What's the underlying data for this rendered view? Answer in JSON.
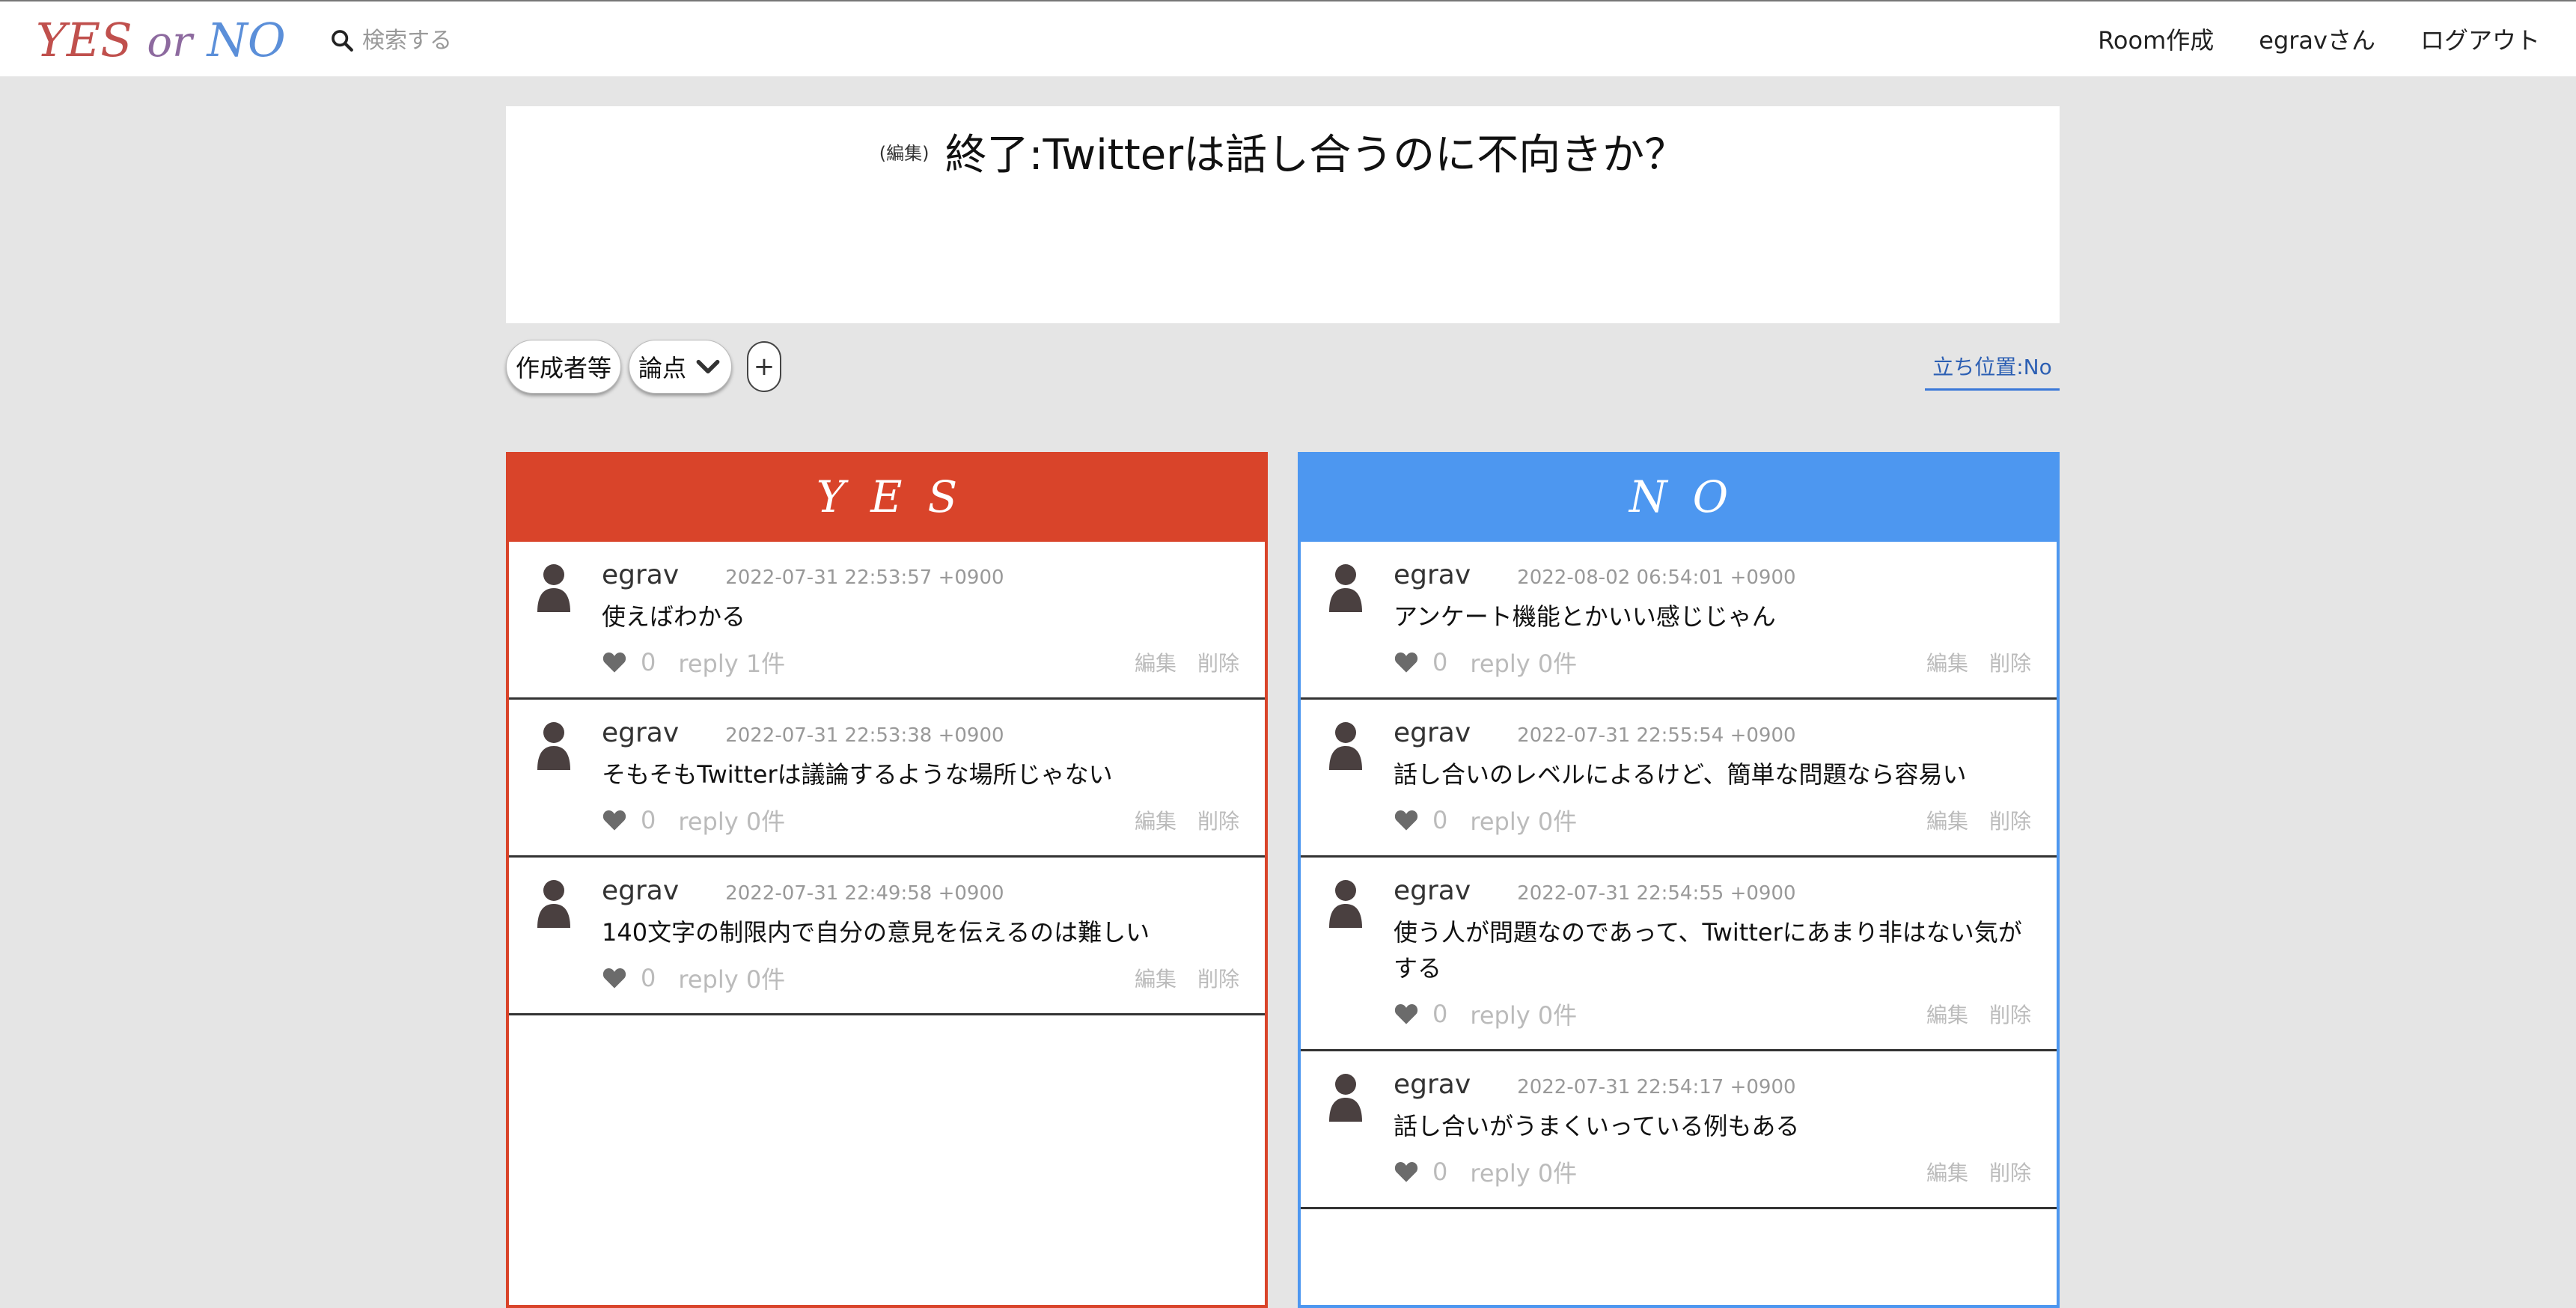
{
  "navbar": {
    "logo": {
      "yes": "YES",
      "or": "or",
      "no": "NO"
    },
    "search_placeholder": "検索する",
    "links": [
      "Room作成",
      "egravさん",
      "ログアウト"
    ]
  },
  "room": {
    "edit_label": "(編集)",
    "title": "終了:Twitterは話し合うのに不向きか？"
  },
  "controls": {
    "author_label": "作成者等",
    "points_label": "論点",
    "add_label": "+",
    "position_label": "立ち位置:No"
  },
  "columns": {
    "yes": {
      "header": "YES",
      "comments": [
        {
          "author": "egrav",
          "time": "2022-07-31 22:53:57 +0900",
          "body": "使えばわかる",
          "likes": "0",
          "reply": "reply 1件",
          "edit": "編集",
          "delete": "削除"
        },
        {
          "author": "egrav",
          "time": "2022-07-31 22:53:38 +0900",
          "body": "そもそもTwitterは議論するような場所じゃない",
          "likes": "0",
          "reply": "reply 0件",
          "edit": "編集",
          "delete": "削除"
        },
        {
          "author": "egrav",
          "time": "2022-07-31 22:49:58 +0900",
          "body": "140文字の制限内で自分の意見を伝えるのは難しい",
          "likes": "0",
          "reply": "reply 0件",
          "edit": "編集",
          "delete": "削除"
        }
      ]
    },
    "no": {
      "header": "NO",
      "comments": [
        {
          "author": "egrav",
          "time": "2022-08-02 06:54:01 +0900",
          "body": "アンケート機能とかいい感じじゃん",
          "likes": "0",
          "reply": "reply 0件",
          "edit": "編集",
          "delete": "削除"
        },
        {
          "author": "egrav",
          "time": "2022-07-31 22:55:54 +0900",
          "body": "話し合いのレベルによるけど、簡単な問題なら容易い",
          "likes": "0",
          "reply": "reply 0件",
          "edit": "編集",
          "delete": "削除"
        },
        {
          "author": "egrav",
          "time": "2022-07-31 22:54:55 +0900",
          "body": "使う人が問題なのであって、Twitterにあまり非はない気がする",
          "likes": "0",
          "reply": "reply 0件",
          "edit": "編集",
          "delete": "削除"
        },
        {
          "author": "egrav",
          "time": "2022-07-31 22:54:17 +0900",
          "body": "話し合いがうまくいっている例もある",
          "likes": "0",
          "reply": "reply 0件",
          "edit": "編集",
          "delete": "削除"
        }
      ]
    }
  },
  "colors": {
    "yes_accent": "#d9442a",
    "no_accent": "#4d97f0",
    "position_accent": "#3b78d8"
  },
  "icons": [
    "search-icon",
    "chevron-down-icon",
    "user-avatar-icon",
    "heart-icon"
  ]
}
